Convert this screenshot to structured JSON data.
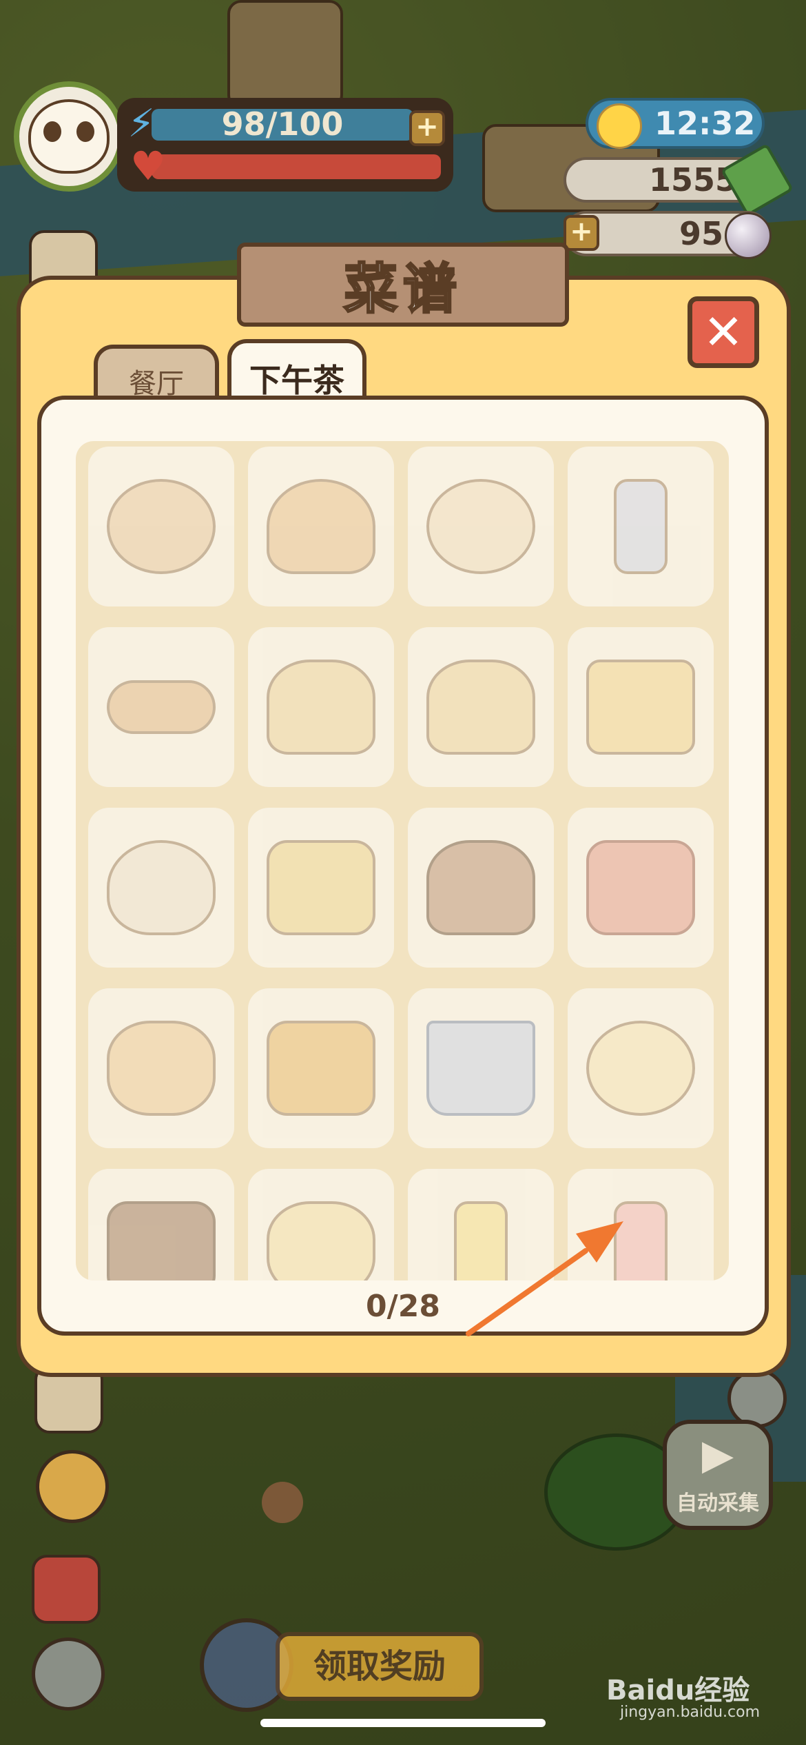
{
  "hud": {
    "energy": "98/100",
    "time": "12:32",
    "coins": "1555",
    "pearls": "95",
    "plus": "+"
  },
  "modal": {
    "title": "菜谱",
    "close": "✕",
    "tabs": [
      {
        "label": "餐厅",
        "active": false
      },
      {
        "label": "下午茶",
        "active": true
      }
    ],
    "progress": "0/28",
    "recipes": [
      {
        "icon": "donut-icon"
      },
      {
        "icon": "croissant-icon"
      },
      {
        "icon": "tart-icon"
      },
      {
        "icon": "flower-bottle-icon"
      },
      {
        "icon": "baguettes-icon"
      },
      {
        "icon": "pudding-icon"
      },
      {
        "icon": "blueberry-pudding-icon"
      },
      {
        "icon": "wrapped-cake-icon"
      },
      {
        "icon": "cookie-bag-icon"
      },
      {
        "icon": "fruit-cake-icon"
      },
      {
        "icon": "cherry-choco-cake-icon"
      },
      {
        "icon": "strawberry-mousse-icon"
      },
      {
        "icon": "swiss-roll-icon"
      },
      {
        "icon": "mango-cake-icon"
      },
      {
        "icon": "blueberry-parfait-icon"
      },
      {
        "icon": "mango-pudding-icon"
      },
      {
        "icon": "chocolate-cake-icon"
      },
      {
        "icon": "berry-tart-icon"
      },
      {
        "icon": "lemon-juice-icon"
      },
      {
        "icon": "peach-juice-icon"
      }
    ]
  },
  "bottom": {
    "reward_button": "领取奖励",
    "auto_collect": "自动采集"
  },
  "watermark": {
    "brand": "Baidu经验",
    "url": "jingyan.baidu.com"
  },
  "colors": {
    "modal_bg": "#ffd981",
    "outline": "#5a3d25",
    "accent_arrow": "#f07830",
    "close_red": "#e4624d"
  }
}
